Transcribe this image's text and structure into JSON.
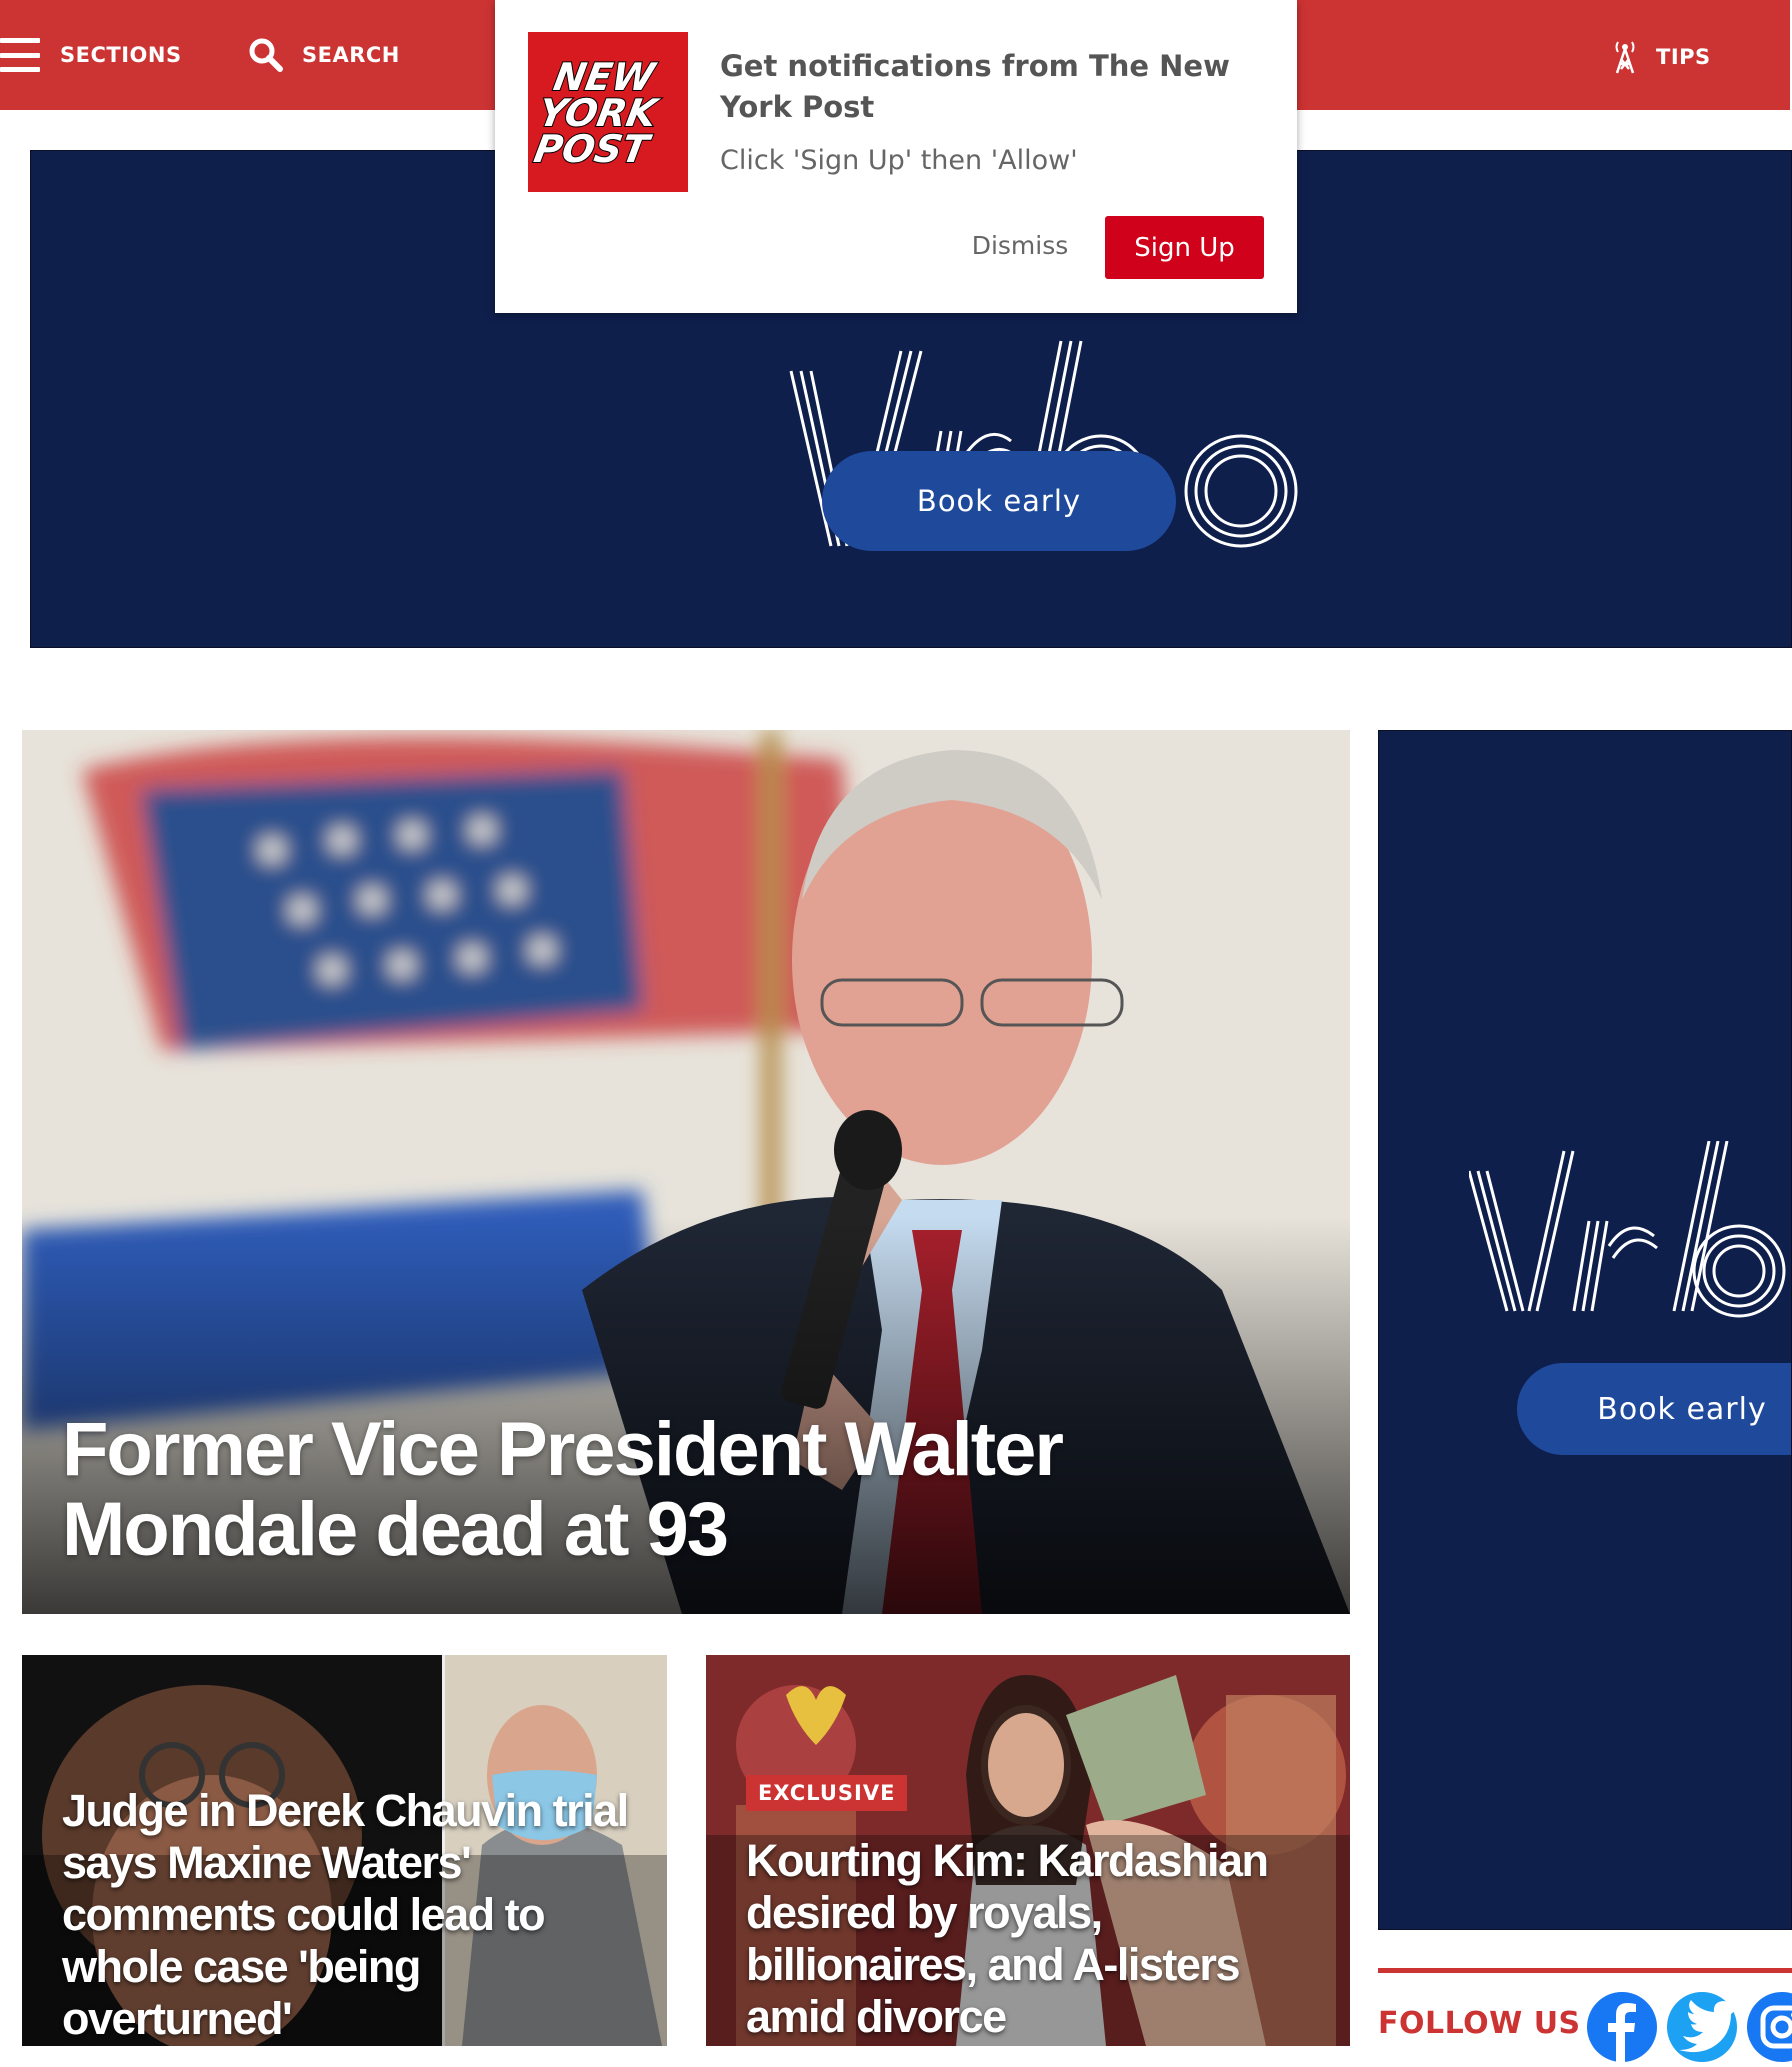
{
  "header": {
    "sections_label": "SECTIONS",
    "search_label": "SEARCH",
    "tips_label": "TIPS"
  },
  "notification": {
    "logo_text": [
      "NEW",
      "YORK",
      "POST"
    ],
    "title": "Get notifications from The New York Post",
    "subtitle": "Click 'Sign Up' then 'Allow'",
    "dismiss_label": "Dismiss",
    "signup_label": "Sign Up"
  },
  "ads": {
    "brand": "Vrbo",
    "top_cta": "Book early",
    "side_cta": "Book early"
  },
  "hero": {
    "title": "Former Vice President Walter Mondale dead at 93"
  },
  "stories": [
    {
      "title": "Judge in Derek Chauvin trial says Maxine Waters' comments could lead to whole case 'being overturned'"
    },
    {
      "badge": "EXCLUSIVE",
      "title": "Kourting Kim: Kardashian desired by royals, billionaires, and A-listers amid divorce"
    }
  ],
  "follow": {
    "label": "FOLLOW US",
    "icons": [
      "facebook-icon",
      "twitter-icon",
      "instagram-icon"
    ]
  },
  "colors": {
    "brand_red": "#cc3333",
    "ad_navy": "#0f1f4c",
    "ad_button": "#1f4a9c",
    "signup_red": "#d0021b"
  }
}
